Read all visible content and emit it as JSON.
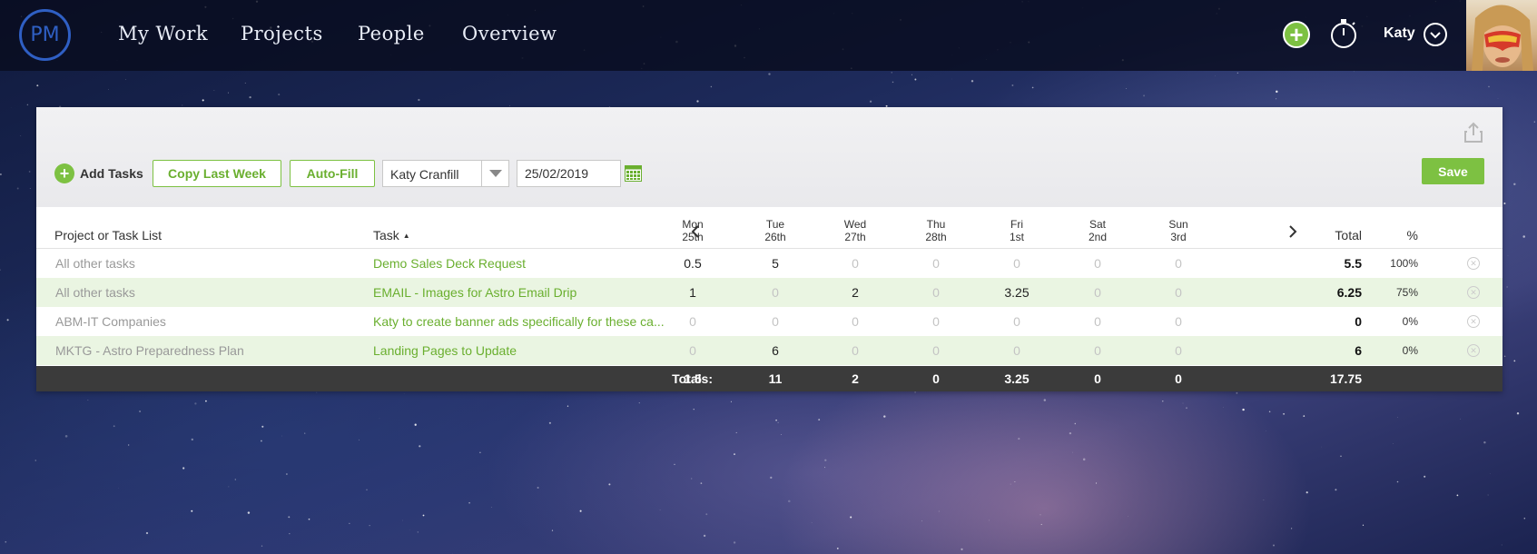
{
  "nav": {
    "logo": "PM",
    "items": [
      "My Work",
      "Projects",
      "People",
      "Overview"
    ],
    "add_icon": "plus-circle-icon",
    "timer_icon": "stopwatch-icon",
    "user_name": "Katy"
  },
  "toolbar": {
    "add_tasks_label": "Add Tasks",
    "copy_last_week_label": "Copy Last Week",
    "auto_fill_label": "Auto-Fill",
    "user_select_value": "Katy Cranfill",
    "date_value": "25/02/2019",
    "save_label": "Save"
  },
  "table": {
    "col_project": "Project or Task List",
    "col_task": "Task",
    "sort_indicator": "▲",
    "col_total": "Total",
    "col_pct": "%",
    "days": [
      {
        "day": "Mon",
        "date": "25th"
      },
      {
        "day": "Tue",
        "date": "26th"
      },
      {
        "day": "Wed",
        "date": "27th"
      },
      {
        "day": "Thu",
        "date": "28th"
      },
      {
        "day": "Fri",
        "date": "1st"
      },
      {
        "day": "Sat",
        "date": "2nd"
      },
      {
        "day": "Sun",
        "date": "3rd"
      }
    ],
    "rows": [
      {
        "project": "All other tasks",
        "task": "Demo Sales Deck Request",
        "hours": [
          "0.5",
          "5",
          "0",
          "0",
          "0",
          "0",
          "0"
        ],
        "total": "5.5",
        "pct": "100%"
      },
      {
        "project": "All other tasks",
        "task": "EMAIL - Images for Astro Email Drip",
        "hours": [
          "1",
          "0",
          "2",
          "0",
          "3.25",
          "0",
          "0"
        ],
        "total": "6.25",
        "pct": "75%"
      },
      {
        "project": "ABM-IT Companies",
        "task": "Katy to create banner ads specifically for these ca...",
        "hours": [
          "0",
          "0",
          "0",
          "0",
          "0",
          "0",
          "0"
        ],
        "total": "0",
        "pct": "0%"
      },
      {
        "project": "MKTG - Astro Preparedness Plan",
        "task": "Landing Pages to Update",
        "hours": [
          "0",
          "6",
          "0",
          "0",
          "0",
          "0",
          "0"
        ],
        "total": "6",
        "pct": "0%"
      }
    ],
    "totals_label": "Totals:",
    "totals": [
      "1.5",
      "11",
      "2",
      "0",
      "3.25",
      "0",
      "0"
    ],
    "grand_total": "17.75"
  },
  "colors": {
    "accent": "#7dc142",
    "alt_row": "#eaf5e2",
    "totals_bg": "#3b3b3b"
  }
}
